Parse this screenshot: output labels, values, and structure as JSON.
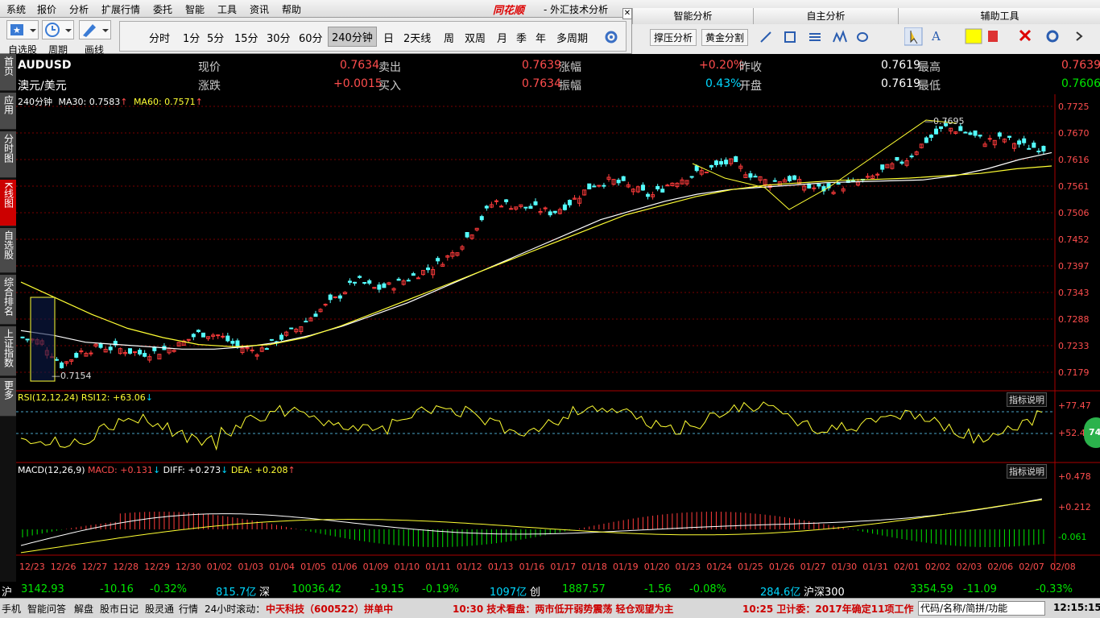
{
  "menu": [
    "系统",
    "报价",
    "分析",
    "扩展行情",
    "委托",
    "智能",
    "工具",
    "资讯",
    "帮助"
  ],
  "brand": "同花顺",
  "window_title": "- 外汇技术分析",
  "toolbar": {
    "left_labels": [
      "自选股",
      "周期",
      "画线"
    ],
    "periods": [
      "分时",
      "1分",
      "5分",
      "15分",
      "30分",
      "60分",
      "240分钟",
      "日",
      "2天线",
      "周",
      "双周",
      "月",
      "季",
      "年",
      "多周期"
    ],
    "active_period": "240分钟"
  },
  "panels": {
    "smart": {
      "title": "智能分析",
      "buttons": [
        "撑压分析",
        "黄金分割"
      ]
    },
    "self": {
      "title": "自主分析"
    },
    "aux": {
      "title": "辅助工具"
    }
  },
  "sidebar": [
    "首页",
    "应用",
    "分时图",
    "K线图",
    "自选股",
    "综合排名",
    "上证指数",
    "更多"
  ],
  "quote": {
    "code": "AUDUSD",
    "name": "澳元/美元",
    "row1": [
      {
        "label": "现价",
        "value": "0.7634",
        "color": "red"
      },
      {
        "label": "卖出",
        "value": "0.7639",
        "color": "red"
      },
      {
        "label": "涨幅",
        "value": "+0.20%",
        "color": "red"
      },
      {
        "label": "昨收",
        "value": "0.7619",
        "color": "wh"
      },
      {
        "label": "最高",
        "value": "0.7639",
        "color": "red"
      }
    ],
    "row2": [
      {
        "label": "涨跌",
        "value": "+0.0015",
        "color": "red"
      },
      {
        "label": "买入",
        "value": "0.7634",
        "color": "red"
      },
      {
        "label": "振幅",
        "value": "0.43%",
        "color": "cy"
      },
      {
        "label": "开盘",
        "value": "0.7619",
        "color": "wh"
      },
      {
        "label": "最低",
        "value": "0.7606",
        "color": "grn"
      }
    ]
  },
  "indicators": {
    "main_label": "240分钟",
    "ma30": "MA30: 0.7583",
    "ma60": "MA60: 0.7571",
    "rsi_label": "RSI(12,12,24) RSI12: +63.06",
    "macd_label": "MACD(12,26,9)",
    "macd_val": "MACD: +0.131",
    "diff_val": "DIFF: +0.273",
    "dea_val": "DEA: +0.208",
    "explain": "指标说明"
  },
  "chart_data": {
    "type": "line",
    "price_axis": [
      "0.7725",
      "0.7670",
      "0.7616",
      "0.7561",
      "0.7506",
      "0.7452",
      "0.7397",
      "0.7343",
      "0.7288",
      "0.7233",
      "0.7179"
    ],
    "rsi_axis": [
      "+77.47",
      "+52.41"
    ],
    "macd_axis": [
      "+0.478",
      "+0.212",
      "-0.061"
    ],
    "x_labels": [
      "12/23",
      "12/26",
      "12/27",
      "12/28",
      "12/29",
      "12/30",
      "01/02",
      "01/03",
      "01/04",
      "01/05",
      "01/06",
      "01/09",
      "01/10",
      "01/11",
      "01/12",
      "01/13",
      "01/16",
      "01/17",
      "01/18",
      "01/19",
      "01/20",
      "01/23",
      "01/24",
      "01/25",
      "01/26",
      "01/27",
      "01/30",
      "01/31",
      "02/01",
      "02/02",
      "02/03",
      "02/06",
      "02/07",
      "02/08"
    ],
    "annotations": {
      "high": "0.7695",
      "low": "0.7154"
    },
    "ylim": [
      0.715,
      0.7725
    ],
    "close_trend": [
      0.7225,
      0.7215,
      0.7165,
      0.7195,
      0.7205,
      0.72,
      0.719,
      0.7195,
      0.721,
      0.7235,
      0.723,
      0.7205,
      0.7195,
      0.722,
      0.7245,
      0.728,
      0.731,
      0.735,
      0.733,
      0.734,
      0.736,
      0.738,
      0.741,
      0.746,
      0.752,
      0.751,
      0.7505,
      0.7495,
      0.752,
      0.7555,
      0.7565,
      0.755,
      0.753,
      0.756,
      0.7575,
      0.759,
      0.7605,
      0.758,
      0.756,
      0.757,
      0.755,
      0.7545,
      0.7555,
      0.7565,
      0.759,
      0.761,
      0.765,
      0.768,
      0.767,
      0.765,
      0.7655,
      0.764,
      0.7634
    ],
    "ma_fast": [
      0.724,
      0.723,
      0.7215,
      0.721,
      0.7205,
      0.72,
      0.72,
      0.7205,
      0.7215,
      0.723,
      0.725,
      0.7275,
      0.73,
      0.733,
      0.736,
      0.739,
      0.742,
      0.745,
      0.748,
      0.75,
      0.752,
      0.7535,
      0.7545,
      0.755,
      0.7555,
      0.756,
      0.7562,
      0.7564,
      0.7566,
      0.7575,
      0.759,
      0.761,
      0.7625
    ],
    "ma_slow": [
      0.7345,
      0.731,
      0.7275,
      0.7245,
      0.7225,
      0.721,
      0.7205,
      0.721,
      0.7225,
      0.725,
      0.728,
      0.731,
      0.734,
      0.737,
      0.74,
      0.743,
      0.746,
      0.749,
      0.751,
      0.753,
      0.7545,
      0.7555,
      0.756,
      0.7565,
      0.7567,
      0.757,
      0.7575,
      0.758,
      0.759,
      0.7596
    ]
  },
  "ticker": {
    "sh_idx": "沪",
    "sh_val": "3142.93",
    "sh_chg": "-10.16",
    "sh_pct": "-0.32%",
    "sh_amt": "815.7亿",
    "sz_idx": "深",
    "sz_val": "10036.42",
    "sz_chg": "-19.15",
    "sz_pct": "-0.19%",
    "sz_amt": "1097亿",
    "cy_idx": "创",
    "cy_val": "1887.57",
    "cy_chg": "-1.56",
    "cy_pct": "-0.08%",
    "cy_amt": "284.6亿",
    "hs_idx": "沪深300",
    "hs_val": "3354.59",
    "hs_chg": "-11.09",
    "hs_pct": "-0.33%"
  },
  "status": {
    "items": [
      "手机",
      "智能问答",
      "解盘",
      "股市日记",
      "股灵通",
      "行情",
      "24小时滚动："
    ],
    "news1": "中天科技（600522）拼单中",
    "news2": "10:30 技术看盘：两市低开弱势震荡 轻仓观望为主",
    "news3": "10:25 卫计委：2017年确定11项工作",
    "search": "代码/名称/简拼/功能",
    "time": "12:15:15",
    "badge": "74"
  }
}
